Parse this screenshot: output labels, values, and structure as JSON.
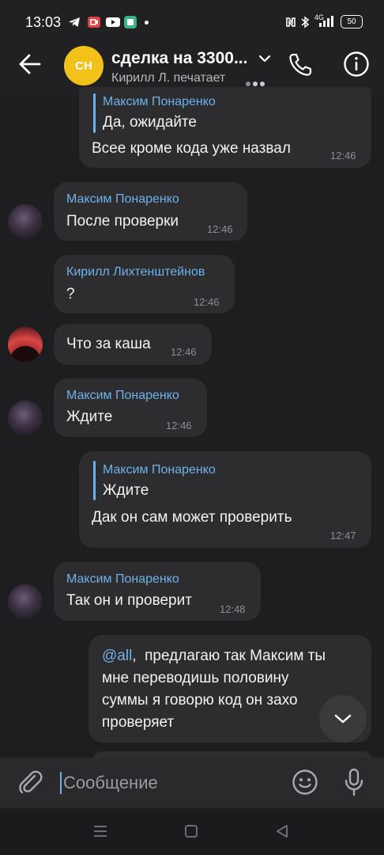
{
  "status_bar": {
    "time": "13:03",
    "network": "4G",
    "battery": "50"
  },
  "header": {
    "avatar_initials": "CH",
    "title": "сделка на 3300...",
    "status": "Кирилл Л. печатает"
  },
  "messages": [
    {
      "id": "m1",
      "quote_author": "Максим Понаренко",
      "quote_text": "Да, ожидайте",
      "text": "Всее кроме кода уже назвал",
      "time": "12:46"
    },
    {
      "id": "m2",
      "sender": "Максим Понаренко",
      "text": "После проверки",
      "time": "12:46"
    },
    {
      "id": "m3",
      "sender": "Кирилл Лихтенштейнов",
      "text": "?",
      "time": "12:46"
    },
    {
      "id": "m4",
      "text": "Что за каша",
      "time": "12:46"
    },
    {
      "id": "m5",
      "sender": "Максим Понаренко",
      "text": "Ждите",
      "time": "12:46"
    },
    {
      "id": "m6",
      "quote_author": "Максим Понаренко",
      "quote_text": "Ждите",
      "text": "Дак он сам может проверить",
      "time": "12:47"
    },
    {
      "id": "m7",
      "sender": "Максим Понаренко",
      "text": "Так он и проверит",
      "time": "12:48"
    },
    {
      "id": "m8",
      "mention": "@all",
      "lines": [
        "предлагаю так Максим ты",
        "мне переводишь половину",
        "суммы я говорю код он захо",
        "проверяет"
      ]
    }
  ],
  "input": {
    "placeholder": "Сообщение"
  },
  "colors": {
    "background": "#1e1e20",
    "bubble": "#2d2d30",
    "accent": "#6fb1ea",
    "avatar_group": "#f3c21a"
  }
}
